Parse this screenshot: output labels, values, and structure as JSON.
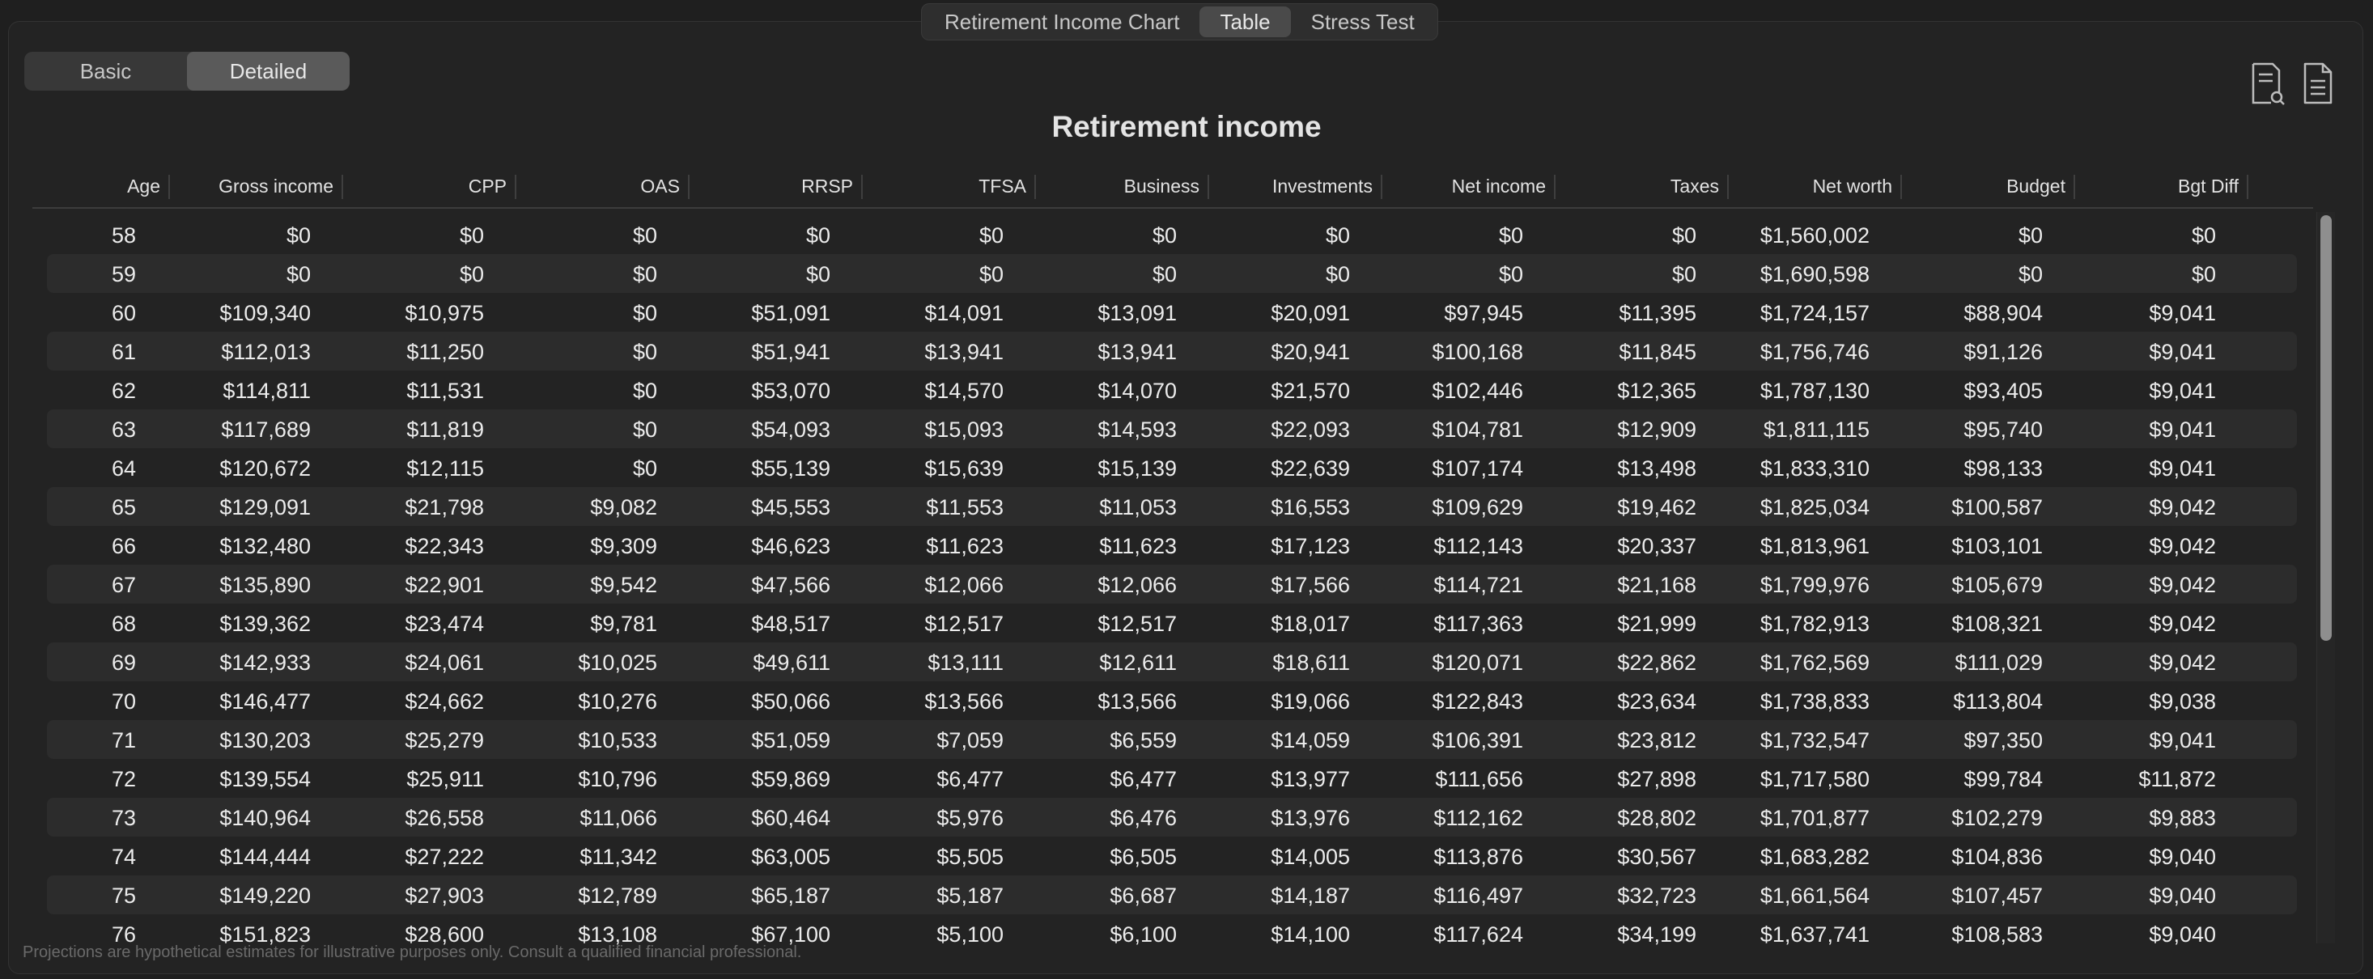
{
  "tabs": [
    {
      "label": "Retirement Income Chart",
      "active": false
    },
    {
      "label": "Table",
      "active": true
    },
    {
      "label": "Stress Test",
      "active": false
    }
  ],
  "view_toggle": {
    "basic": "Basic",
    "detailed": "Detailed",
    "selected": "Detailed"
  },
  "toolbar": {
    "icons": [
      "document-search-icon",
      "document-icon"
    ]
  },
  "title": "Retirement income",
  "table": {
    "columns": [
      "Age",
      "Gross income",
      "CPP",
      "OAS",
      "RRSP",
      "TFSA",
      "Business",
      "Investments",
      "Net income",
      "Taxes",
      "Net worth",
      "Budget",
      "Bgt Diff"
    ],
    "rows": [
      [
        "58",
        "$0",
        "$0",
        "$0",
        "$0",
        "$0",
        "$0",
        "$0",
        "$0",
        "$0",
        "$1,560,002",
        "$0",
        "$0"
      ],
      [
        "59",
        "$0",
        "$0",
        "$0",
        "$0",
        "$0",
        "$0",
        "$0",
        "$0",
        "$0",
        "$1,690,598",
        "$0",
        "$0"
      ],
      [
        "60",
        "$109,340",
        "$10,975",
        "$0",
        "$51,091",
        "$14,091",
        "$13,091",
        "$20,091",
        "$97,945",
        "$11,395",
        "$1,724,157",
        "$88,904",
        "$9,041"
      ],
      [
        "61",
        "$112,013",
        "$11,250",
        "$0",
        "$51,941",
        "$13,941",
        "$13,941",
        "$20,941",
        "$100,168",
        "$11,845",
        "$1,756,746",
        "$91,126",
        "$9,041"
      ],
      [
        "62",
        "$114,811",
        "$11,531",
        "$0",
        "$53,070",
        "$14,570",
        "$14,070",
        "$21,570",
        "$102,446",
        "$12,365",
        "$1,787,130",
        "$93,405",
        "$9,041"
      ],
      [
        "63",
        "$117,689",
        "$11,819",
        "$0",
        "$54,093",
        "$15,093",
        "$14,593",
        "$22,093",
        "$104,781",
        "$12,909",
        "$1,811,115",
        "$95,740",
        "$9,041"
      ],
      [
        "64",
        "$120,672",
        "$12,115",
        "$0",
        "$55,139",
        "$15,639",
        "$15,139",
        "$22,639",
        "$107,174",
        "$13,498",
        "$1,833,310",
        "$98,133",
        "$9,041"
      ],
      [
        "65",
        "$129,091",
        "$21,798",
        "$9,082",
        "$45,553",
        "$11,553",
        "$11,053",
        "$16,553",
        "$109,629",
        "$19,462",
        "$1,825,034",
        "$100,587",
        "$9,042"
      ],
      [
        "66",
        "$132,480",
        "$22,343",
        "$9,309",
        "$46,623",
        "$11,623",
        "$11,623",
        "$17,123",
        "$112,143",
        "$20,337",
        "$1,813,961",
        "$103,101",
        "$9,042"
      ],
      [
        "67",
        "$135,890",
        "$22,901",
        "$9,542",
        "$47,566",
        "$12,066",
        "$12,066",
        "$17,566",
        "$114,721",
        "$21,168",
        "$1,799,976",
        "$105,679",
        "$9,042"
      ],
      [
        "68",
        "$139,362",
        "$23,474",
        "$9,781",
        "$48,517",
        "$12,517",
        "$12,517",
        "$18,017",
        "$117,363",
        "$21,999",
        "$1,782,913",
        "$108,321",
        "$9,042"
      ],
      [
        "69",
        "$142,933",
        "$24,061",
        "$10,025",
        "$49,611",
        "$13,111",
        "$12,611",
        "$18,611",
        "$120,071",
        "$22,862",
        "$1,762,569",
        "$111,029",
        "$9,042"
      ],
      [
        "70",
        "$146,477",
        "$24,662",
        "$10,276",
        "$50,066",
        "$13,566",
        "$13,566",
        "$19,066",
        "$122,843",
        "$23,634",
        "$1,738,833",
        "$113,804",
        "$9,038"
      ],
      [
        "71",
        "$130,203",
        "$25,279",
        "$10,533",
        "$51,059",
        "$7,059",
        "$6,559",
        "$14,059",
        "$106,391",
        "$23,812",
        "$1,732,547",
        "$97,350",
        "$9,041"
      ],
      [
        "72",
        "$139,554",
        "$25,911",
        "$10,796",
        "$59,869",
        "$6,477",
        "$6,477",
        "$13,977",
        "$111,656",
        "$27,898",
        "$1,717,580",
        "$99,784",
        "$11,872"
      ],
      [
        "73",
        "$140,964",
        "$26,558",
        "$11,066",
        "$60,464",
        "$5,976",
        "$6,476",
        "$13,976",
        "$112,162",
        "$28,802",
        "$1,701,877",
        "$102,279",
        "$9,883"
      ],
      [
        "74",
        "$144,444",
        "$27,222",
        "$11,342",
        "$63,005",
        "$5,505",
        "$6,505",
        "$14,005",
        "$113,876",
        "$30,567",
        "$1,683,282",
        "$104,836",
        "$9,040"
      ],
      [
        "75",
        "$149,220",
        "$27,903",
        "$12,789",
        "$65,187",
        "$5,187",
        "$6,687",
        "$14,187",
        "$116,497",
        "$32,723",
        "$1,661,564",
        "$107,457",
        "$9,040"
      ],
      [
        "76",
        "$151,823",
        "$28,600",
        "$13,108",
        "$67,100",
        "$5,100",
        "$6,100",
        "$14,100",
        "$117,624",
        "$34,199",
        "$1,637,741",
        "$108,583",
        "$9,040"
      ]
    ]
  },
  "footer": "Projections are hypothetical estimates for illustrative purposes only. Consult a qualified financial professional."
}
